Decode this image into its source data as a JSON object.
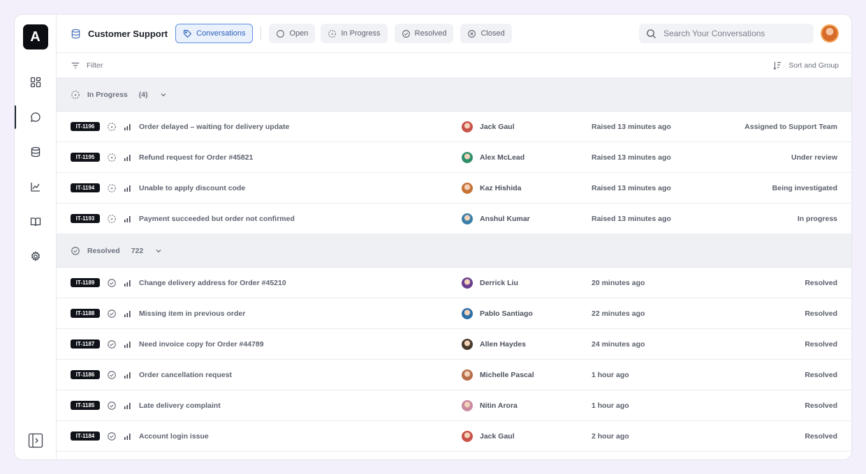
{
  "sidebar": {
    "logo_letter": "A",
    "items": [
      {
        "icon": "dashboard-icon"
      },
      {
        "icon": "chat-icon",
        "active": true
      },
      {
        "icon": "database-icon"
      },
      {
        "icon": "chart-icon"
      },
      {
        "icon": "book-icon"
      },
      {
        "icon": "gear-icon"
      }
    ]
  },
  "header": {
    "title": "Customer Support",
    "tabs": [
      {
        "label": "Conversations",
        "icon": "tag-icon",
        "active": true
      },
      {
        "label": "Open",
        "icon": "circle-icon"
      },
      {
        "label": "In Progress",
        "icon": "dashed-circle-icon"
      },
      {
        "label": "Resolved",
        "icon": "check-circle-icon"
      },
      {
        "label": "Closed",
        "icon": "x-circle-icon"
      }
    ],
    "search_placeholder": "Search Your Conversations"
  },
  "toolbar": {
    "filter_label": "Filter",
    "sort_label": "Sort and Group"
  },
  "groups": [
    {
      "label": "In Progress",
      "count": "(4)",
      "status": "in-progress",
      "rows": [
        {
          "id": "IT-1196",
          "title": "Order delayed – waiting for delivery update",
          "person": "Jack Gaul",
          "time": "Raised 13 minutes ago",
          "state": "Assigned to Support Team",
          "avatar_color": "#c9524b"
        },
        {
          "id": "IT-1195",
          "title": "Refund request for Order #45821",
          "person": "Alex McLead",
          "time": "Raised 13 minutes ago",
          "state": "Under review",
          "avatar_color": "#2f8f6a"
        },
        {
          "id": "IT-1194",
          "title": "Unable to apply discount code",
          "person": "Kaz Hishida",
          "time": "Raised 13 minutes ago",
          "state": "Being investigated",
          "avatar_color": "#c8733a"
        },
        {
          "id": "IT-1193",
          "title": "Payment succeeded but order not confirmed",
          "person": "Anshul Kumar",
          "time": "Raised 13 minutes ago",
          "state": "In progress",
          "avatar_color": "#3b7fa8"
        }
      ]
    },
    {
      "label": "Resolved",
      "count": "722",
      "status": "resolved",
      "rows": [
        {
          "id": "IT-1189",
          "title": "Change delivery address for Order #45210",
          "person": "Derrick Liu",
          "time": "20 minutes ago",
          "state": "Resolved",
          "avatar_color": "#6b3f8f"
        },
        {
          "id": "IT-1188",
          "title": "Missing item in previous order",
          "person": "Pablo Santiago",
          "time": "22 minutes ago",
          "state": "Resolved",
          "avatar_color": "#2f6fa8"
        },
        {
          "id": "IT-1187",
          "title": "Need invoice copy for Order #44789",
          "person": "Allen Haydes",
          "time": "24 minutes ago",
          "state": "Resolved",
          "avatar_color": "#4a3a2c"
        },
        {
          "id": "IT-1186",
          "title": "Order cancellation request",
          "person": "Michelle Pascal",
          "time": "1 hour ago",
          "state": "Resolved",
          "avatar_color": "#b76e4a"
        },
        {
          "id": "IT-1185",
          "title": "Late delivery complaint",
          "person": "Nitin Arora",
          "time": "1 hour ago",
          "state": "Resolved",
          "avatar_color": "#c98aa0"
        },
        {
          "id": "IT-1184",
          "title": "Account login issue",
          "person": "Jack Gaul",
          "time": "2 hour ago",
          "state": "Resolved",
          "avatar_color": "#c9524b"
        }
      ]
    }
  ]
}
